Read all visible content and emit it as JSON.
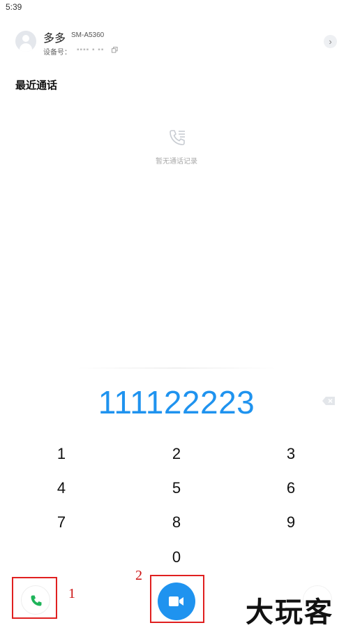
{
  "status_bar": {
    "time": "5:39"
  },
  "device": {
    "name": "多多",
    "model": "SM-A5360",
    "id_label": "设备号：",
    "id_value": "▪▪▪▪ ▪ ▪▪"
  },
  "recent_calls": {
    "title": "最近通话",
    "empty_text": "暂无通话记录"
  },
  "dialer": {
    "number": "111122223",
    "keys": [
      "1",
      "2",
      "3",
      "4",
      "5",
      "6",
      "7",
      "8",
      "9",
      "0"
    ]
  },
  "annotations": {
    "label_1": "1",
    "label_2": "2"
  },
  "watermark": {
    "text": "大玩客"
  },
  "colors": {
    "accent": "#1f93ef",
    "call_green": "#1fb45a",
    "highlight": "#e02020"
  },
  "icons": {
    "avatar": "person-icon",
    "copy": "copy-icon",
    "chevron": "chevron-right-icon",
    "empty": "phone-list-icon",
    "backspace": "backspace-icon",
    "call": "phone-icon",
    "video": "video-camera-icon"
  }
}
